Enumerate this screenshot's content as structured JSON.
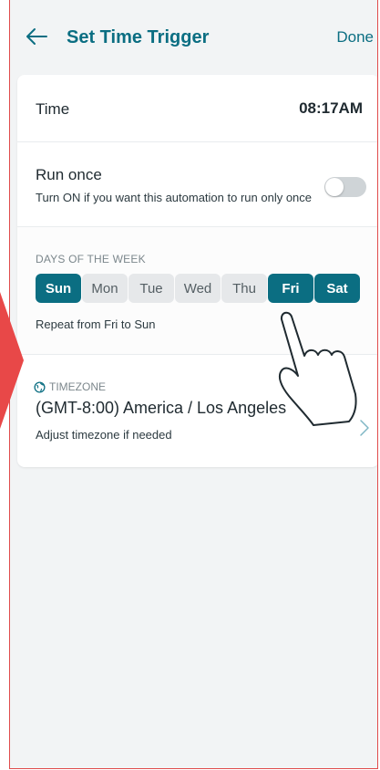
{
  "header": {
    "title": "Set Time Trigger",
    "done_label": "Done",
    "back_icon": "arrow-left-icon"
  },
  "time": {
    "label": "Time",
    "value": "08:17AM"
  },
  "run_once": {
    "label": "Run once",
    "description": "Turn ON if you want this automation to run only once",
    "enabled": false
  },
  "days": {
    "heading": "DAYS OF THE WEEK",
    "items": [
      {
        "label": "Sun",
        "selected": true
      },
      {
        "label": "Mon",
        "selected": false
      },
      {
        "label": "Tue",
        "selected": false
      },
      {
        "label": "Wed",
        "selected": false
      },
      {
        "label": "Thu",
        "selected": false
      },
      {
        "label": "Fri",
        "selected": true
      },
      {
        "label": "Sat",
        "selected": true
      }
    ],
    "repeat_text": "Repeat from Fri to Sun"
  },
  "timezone": {
    "heading": "TIMEZONE",
    "value": "(GMT-8:00) America / Los Angeles",
    "description": "Adjust timezone if needed",
    "icon": "globe-icon"
  },
  "colors": {
    "accent": "#0b6e82",
    "background": "#f2f4f5",
    "marker": "#e84848"
  }
}
